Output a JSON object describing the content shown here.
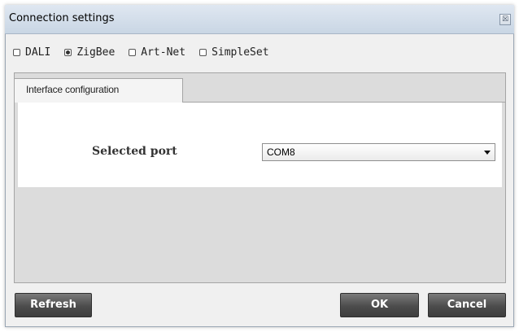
{
  "window": {
    "title": "Connection settings",
    "close_glyph": "☒",
    "close_icon": "close-icon"
  },
  "protocols": [
    {
      "label": "DALI",
      "selected": false
    },
    {
      "label": "ZigBee",
      "selected": true
    },
    {
      "label": "Art-Net",
      "selected": false
    },
    {
      "label": "SimpleSet",
      "selected": false
    }
  ],
  "tabs": [
    {
      "label": "Interface configuration",
      "active": true
    }
  ],
  "port": {
    "label": "Selected port",
    "value": "COM8",
    "dropdown_icon": "chevron-down-icon"
  },
  "buttons": {
    "refresh_label": "Refresh",
    "ok_label": "OK",
    "cancel_label": "Cancel"
  },
  "colors": {
    "button_bg": "#4c4c4c",
    "button_text": "#ffffff",
    "titlebar_bg": "#d3dde9",
    "panel_bg": "#ffffff",
    "tab_area_bg": "#dcdcdc"
  }
}
